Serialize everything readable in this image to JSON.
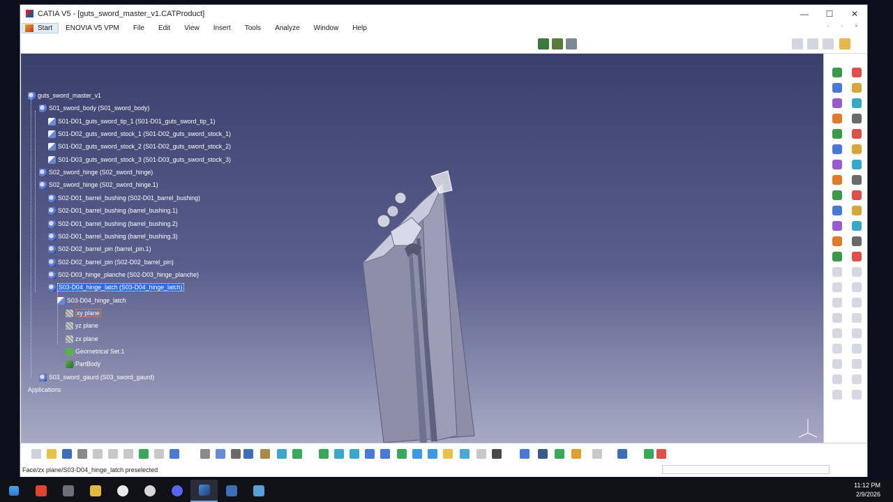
{
  "window": {
    "title": "CATIA V5 - [guts_sword_master_v1.CATProduct]"
  },
  "window_controls": {
    "minimize": "—",
    "maximize": "☐",
    "close": "✕"
  },
  "menu": {
    "start": "Start",
    "items": [
      "ENOVIA V5 VPM",
      "File",
      "Edit",
      "View",
      "Insert",
      "Tools",
      "Analyze",
      "Window",
      "Help"
    ],
    "doc_controls": "- ▫ ×"
  },
  "tree": {
    "root": "guts_sword_master_v1",
    "nodes": [
      {
        "label": "S01_sword_body (S01_sword_body)",
        "icon": "product-icon"
      },
      {
        "label": "S01-D01_guts_sword_tip_1 (S01-D01_guts_sword_tip_1)",
        "icon": "part-icon"
      },
      {
        "label": "S01-D02_guts_sword_stock_1 (S01-D02_guts_sword_stock_1)",
        "icon": "part-icon"
      },
      {
        "label": "S01-D02_guts_sword_stock_2 (S01-D02_guts_sword_stock_2)",
        "icon": "part-icon"
      },
      {
        "label": "S01-D03_guts_sword_stock_3 (S01-D03_guts_sword_stock_3)",
        "icon": "part-icon"
      },
      {
        "label": "S02_sword_hinge (S02_sword_hinge)",
        "icon": "product-icon"
      },
      {
        "label": "S02_sword_hinge (S02_sword_hinge.1)",
        "icon": "product-icon"
      },
      {
        "label": "S02-D01_barrel_bushing (S02-D01_barrel_bushing)",
        "icon": "product-icon"
      },
      {
        "label": "S02-D01_barrel_bushing (barrel_bushing.1)",
        "icon": "product-icon"
      },
      {
        "label": "S02-D01_barrel_bushing (barrel_bushing.2)",
        "icon": "product-icon"
      },
      {
        "label": "S02-D01_barrel_bushing (barrel_bushing.3)",
        "icon": "product-icon"
      },
      {
        "label": "S02-D02_barrel_pin (barrel_pin.1)",
        "icon": "product-icon"
      },
      {
        "label": "S02-D02_barrel_pin (S02-D02_barrel_pin)",
        "icon": "product-icon"
      },
      {
        "label": "S02-D03_hinge_planche (S02-D03_hinge_planche)",
        "icon": "product-icon"
      },
      {
        "label": "S03-D04_hinge_latch (S03-D04_hinge_latch)",
        "icon": "product-icon",
        "selected": true
      },
      {
        "label": "S03-D04_hinge_latch",
        "icon": "part-icon"
      },
      {
        "label": "xy plane",
        "icon": "plane-icon",
        "highlighted": true
      },
      {
        "label": "yz plane",
        "icon": "plane-icon"
      },
      {
        "label": "zx plane",
        "icon": "plane-icon"
      },
      {
        "label": "Geometrical Set.1",
        "icon": "geometrical-set-icon"
      },
      {
        "label": "PartBody",
        "icon": "partbody-icon"
      },
      {
        "label": "S03_sword_gaurd (S03_sword_gaurd)",
        "icon": "product-icon"
      },
      {
        "label": "Applications",
        "icon": ""
      }
    ]
  },
  "status": {
    "message": "Face/zx plane/S03-D04_hinge_latch preselected"
  },
  "taskbar": {
    "apps": [
      "windows-start-icon",
      "brave-browser-icon",
      "terminal-icon",
      "file-explorer-icon",
      "obs-icon",
      "chatgpt-icon",
      "discord-icon",
      "catia-icon",
      "calculator-icon",
      "snipping-tool-icon"
    ],
    "time": "11:12 PM",
    "date": "2/9/2026"
  },
  "colors": {
    "viewport_top": "#3b3f6c",
    "viewport_bottom": "#a7a9c4",
    "selection": "#2d6be0",
    "preselect": "#e07a2a"
  }
}
